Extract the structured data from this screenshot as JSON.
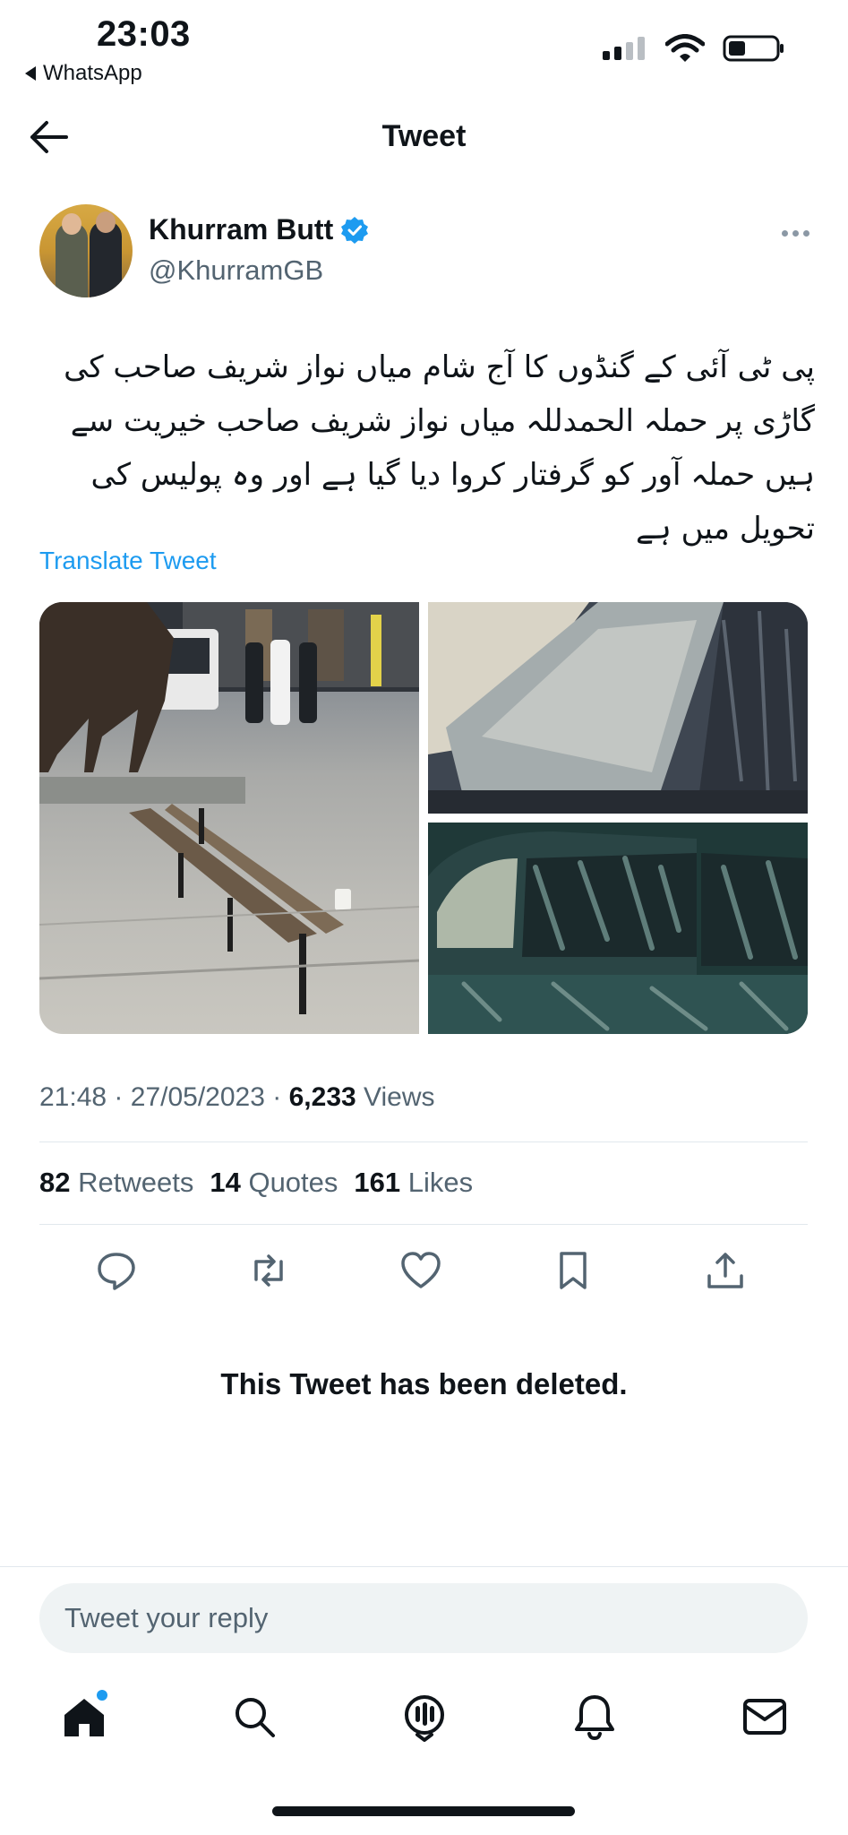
{
  "status_bar": {
    "time": "23:03",
    "back_app": "WhatsApp"
  },
  "header": {
    "title": "Tweet"
  },
  "author": {
    "name": "Khurram Butt",
    "handle": "@KhurramGB",
    "verified": true
  },
  "tweet": {
    "text": "پی ٹی آئی کے گنڈوں کا آج شام میاں نواز شریف صاحب کی گاڑی پر حملہ الحمدللہ میاں نواز شریف صاحب خیریت سے ہیں حملہ آور کو گرفتار کروا دیا گیا ہے اور وہ پولیس کی تحویل میں ہے",
    "translate_label": "Translate Tweet",
    "time": "21:48",
    "date": "27/05/2023",
    "separator": "·",
    "views_count": "6,233",
    "views_label": "Views"
  },
  "stats": {
    "retweets_count": "82",
    "retweets_label": "Retweets",
    "quotes_count": "14",
    "quotes_label": "Quotes",
    "likes_count": "161",
    "likes_label": "Likes"
  },
  "actions": [
    "reply-icon",
    "retweet-icon",
    "like-icon",
    "bookmark-icon",
    "share-icon"
  ],
  "deleted_notice": "This Tweet has been deleted.",
  "reply": {
    "placeholder": "Tweet your reply"
  },
  "bottom_nav": [
    "home-icon",
    "search-icon",
    "spaces-icon",
    "notifications-icon",
    "messages-icon"
  ],
  "colors": {
    "accent": "#1d9bf0",
    "text_primary": "#0f1419",
    "text_secondary": "#536471",
    "divider": "#e1e8ed",
    "reply_bg": "#eff3f4"
  }
}
